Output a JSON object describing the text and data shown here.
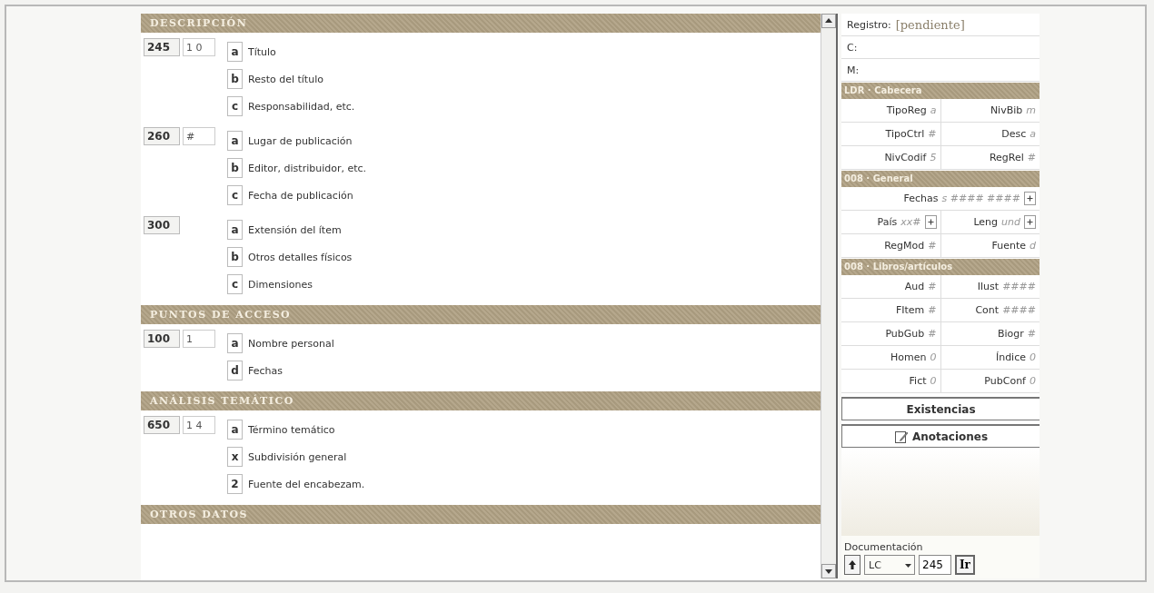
{
  "sections": [
    {
      "title": "DESCRIPCIÓN",
      "fields": [
        {
          "tag": "245",
          "indicators": "1 0",
          "subfields": [
            {
              "code": "a",
              "label": "Título"
            },
            {
              "code": "b",
              "label": "Resto del título"
            },
            {
              "code": "c",
              "label": "Responsabilidad, etc."
            }
          ]
        },
        {
          "tag": "260",
          "indicators": "#",
          "subfields": [
            {
              "code": "a",
              "label": "Lugar de publicación"
            },
            {
              "code": "b",
              "label": "Editor, distribuidor, etc."
            },
            {
              "code": "c",
              "label": "Fecha de publicación"
            }
          ]
        },
        {
          "tag": "300",
          "subfields": [
            {
              "code": "a",
              "label": "Extensión del ítem"
            },
            {
              "code": "b",
              "label": "Otros detalles físicos"
            },
            {
              "code": "c",
              "label": "Dimensiones"
            }
          ]
        }
      ]
    },
    {
      "title": "PUNTOS DE ACCESO",
      "fields": [
        {
          "tag": "100",
          "indicators": "1",
          "subfields": [
            {
              "code": "a",
              "label": "Nombre personal"
            },
            {
              "code": "d",
              "label": "Fechas"
            }
          ]
        }
      ]
    },
    {
      "title": "ANÁLISIS TEMÁTICO",
      "fields": [
        {
          "tag": "650",
          "indicators": "1 4",
          "subfields": [
            {
              "code": "a",
              "label": "Término temático"
            },
            {
              "code": "x",
              "label": "Subdivisión general"
            },
            {
              "code": "2",
              "label": "Fuente del encabezam."
            }
          ]
        }
      ]
    },
    {
      "title": "OTROS DATOS"
    }
  ],
  "record": {
    "label": "Registro:",
    "status": "[pendiente]",
    "lines": [
      "C:",
      "M:"
    ]
  },
  "fixed_blocks": [
    {
      "title": "LDR · Cabecera",
      "rows": [
        [
          {
            "label": "TipoReg",
            "value": "a"
          },
          {
            "label": "NivBib",
            "value": "m"
          }
        ],
        [
          {
            "label": "TipoCtrl",
            "value": "#"
          },
          {
            "label": "Desc",
            "value": "a"
          }
        ],
        [
          {
            "label": "NivCodif",
            "value": "5"
          },
          {
            "label": "RegRel",
            "value": "#"
          }
        ]
      ]
    },
    {
      "title": "008 · General",
      "rows": [
        [
          {
            "label": "Fechas",
            "value": "s  ####  ####",
            "expand": true
          }
        ],
        [
          {
            "label": "País",
            "value": "xx#",
            "expand": true
          },
          {
            "label": "Leng",
            "value": "und",
            "expand": true
          }
        ],
        [
          {
            "label": "RegMod",
            "value": "#"
          },
          {
            "label": "Fuente",
            "value": "d"
          }
        ]
      ]
    },
    {
      "title": "008 · Libros/artículos",
      "rows": [
        [
          {
            "label": "Aud",
            "value": "#"
          },
          {
            "label": "Ilust",
            "value": "####"
          }
        ],
        [
          {
            "label": "FItem",
            "value": "#"
          },
          {
            "label": "Cont",
            "value": "####"
          }
        ],
        [
          {
            "label": "PubGub",
            "value": "#"
          },
          {
            "label": "Biogr",
            "value": "#"
          }
        ],
        [
          {
            "label": "Homen",
            "value": "0"
          },
          {
            "label": "Índice",
            "value": "0"
          }
        ],
        [
          {
            "label": "Fict",
            "value": "0"
          },
          {
            "label": "PubConf",
            "value": "0"
          }
        ]
      ]
    }
  ],
  "actions": [
    {
      "label": "Existencias",
      "kind": "plain"
    },
    {
      "label": "Anotaciones",
      "kind": "note"
    }
  ],
  "documentation": {
    "label": "Documentación",
    "scheme": "LC",
    "tag": "245",
    "go": "Ir"
  }
}
